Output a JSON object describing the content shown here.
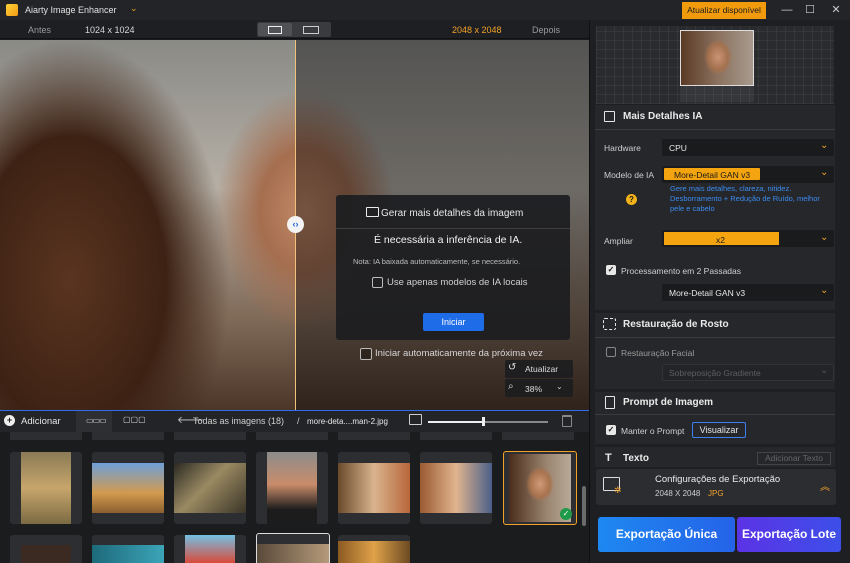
{
  "window": {
    "title": "Aiarty Image Enhancer",
    "update_button": "Atualizar disponível",
    "controls": [
      "minimize-icon",
      "maximize-icon",
      "close-icon"
    ]
  },
  "compare": {
    "before_label": "Antes",
    "before_size": "1024 x 1024",
    "after_size": "2048 x 2048",
    "after_label": "Depois"
  },
  "dialog": {
    "title": "Gerar mais detalhes da imagem",
    "message": "É necessária a inferência de IA.",
    "note": "Nota: IA baixada automaticamente, se necessário.",
    "local_models_label": "Use apenas modelos de IA locais",
    "start_button": "Iniciar",
    "auto_start_label": "Iniciar automaticamente da próxima vez"
  },
  "view_tools": {
    "refresh_label": "Atualizar",
    "zoom": "38%"
  },
  "thumb_toolbar": {
    "add_label": "Adicionar",
    "all_images": "Todas as imagens (18)",
    "separator": "/",
    "filename": "more-deta....man-2.jpg",
    "thumb_size": 0.47
  },
  "right_panel": {
    "details": {
      "title": "Mais Detalhes IA",
      "hardware_label": "Hardware",
      "hardware_value": "CPU",
      "model_label": "Modelo de IA",
      "model_value": "More-Detail GAN  v3",
      "model_hint": "Gere mais detalhes, clareza, nitidez. Desborramento + Redução de Ruído, melhor pele e cabelo",
      "upscale_label": "Ampliar",
      "upscale_value": "x2",
      "two_pass_label": "Processamento em 2 Passadas",
      "two_pass_checked": true,
      "two_pass_model": "More-Detail GAN  v3"
    },
    "face": {
      "title": "Restauração de Rosto",
      "facial_label": "Restauração Facial",
      "facial_checked": false,
      "blend_value": "Sobreposição Gradiente"
    },
    "prompt": {
      "title": "Prompt de Imagem",
      "keep_label": "Manter o Prompt",
      "keep_checked": true,
      "view_button": "Visualizar"
    },
    "text": {
      "title": "Texto",
      "add_button": "Adicionar Texto"
    },
    "export": {
      "title": "Configurações de Exportação",
      "size": "2048 X 2048",
      "format": "JPG",
      "single_button": "Exportação Única",
      "batch_button": "Exportação Lote"
    }
  },
  "colors": {
    "accent": "#f3a40f",
    "blue": "#1f6ce8",
    "hint_blue": "#3b8cf2"
  }
}
